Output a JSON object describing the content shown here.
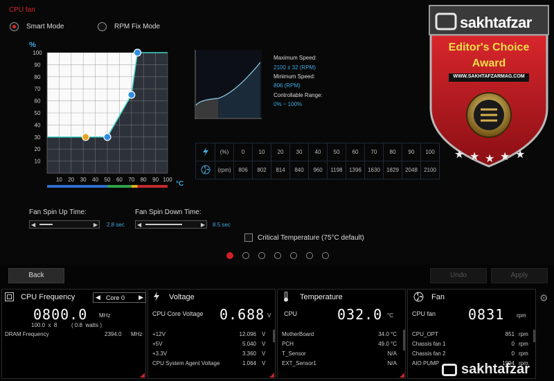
{
  "title": "CPU fan",
  "modes": [
    {
      "label": "Smart Mode",
      "selected": true
    },
    {
      "label": "RPM Fix Mode",
      "selected": false
    }
  ],
  "chart_data": {
    "type": "line",
    "ylabel": "%",
    "xlabel": "°C",
    "xlim": [
      0,
      100
    ],
    "ylim": [
      0,
      100
    ],
    "x_ticks": [
      10,
      20,
      30,
      40,
      50,
      60,
      70,
      80,
      90,
      100
    ],
    "y_ticks": [
      10,
      20,
      30,
      40,
      50,
      60,
      70,
      80,
      90,
      100
    ],
    "points": [
      {
        "x": 0,
        "y": 30
      },
      {
        "x": 32,
        "y": 30
      },
      {
        "x": 50,
        "y": 30
      },
      {
        "x": 70,
        "y": 65
      },
      {
        "x": 75,
        "y": 100
      },
      {
        "x": 100,
        "y": 100
      }
    ],
    "handles": [
      {
        "x": 32,
        "y": 30,
        "color": "#e8a21c"
      },
      {
        "x": 50,
        "y": 30,
        "color": "#2f8ee0"
      },
      {
        "x": 70,
        "y": 65,
        "color": "#2f8ee0"
      },
      {
        "x": 75,
        "y": 100,
        "color": "#2f8ee0"
      }
    ],
    "zones": [
      {
        "from": 0,
        "to": 50,
        "color": "#2f6fd0"
      },
      {
        "from": 50,
        "to": 70,
        "color": "#2fa34a"
      },
      {
        "from": 70,
        "to": 75,
        "color": "#e0b020"
      },
      {
        "from": 75,
        "to": 100,
        "color": "#c42a2a"
      }
    ]
  },
  "specs": {
    "max_label": "Maximum Speed:",
    "max_value": "2100 ± 32 (RPM)",
    "min_label": "Minimum Speed:",
    "min_value": "806 (RPM)",
    "range_label": "Controllable Range:",
    "range_value": "0% ~ 100%"
  },
  "speed_table": {
    "pct_header": "(%)",
    "rpm_header": "(rpm)",
    "pct": [
      "0",
      "10",
      "20",
      "30",
      "40",
      "50",
      "60",
      "70",
      "80",
      "90",
      "100"
    ],
    "rpm": [
      "806",
      "802",
      "814",
      "840",
      "960",
      "1198",
      "1396",
      "1630",
      "1829",
      "2048",
      "2100"
    ]
  },
  "spin_up": {
    "label": "Fan Spin Up Time:",
    "value": "2.8 sec",
    "level": 0.25
  },
  "spin_down": {
    "label": "Fan Spin Down Time:",
    "value": "8.5 sec",
    "level": 0.7
  },
  "critical": {
    "label": "Critical Temperature (75°C default)",
    "checked": false
  },
  "pages": {
    "count": 7,
    "current": 0
  },
  "buttons": {
    "back": "Back",
    "undo": "Undo",
    "apply": "Apply"
  },
  "badge": {
    "brand": "sakhtafzar",
    "line1": "Editor's Choice",
    "line2": "Award",
    "url": "WWW.SAKHTAFZARMAG.COM",
    "stars": 5
  },
  "watermark": "sakhtafzar",
  "cpu": {
    "title": "CPU Frequency",
    "core": "Core 0",
    "freq": "0800.0",
    "unit": "MHz",
    "ratio": "100.0  x  8",
    "watts": "( 0.8  watts )",
    "dram_label": "DRAM Frequency",
    "dram_value": "2394.0",
    "dram_unit": "MHz"
  },
  "voltage": {
    "title": "Voltage",
    "core_label": "CPU Core Voltage",
    "core_value": "0.688",
    "unit": "V",
    "rows": [
      {
        "label": "+12V",
        "value": "12.096",
        "unit": "V"
      },
      {
        "label": "+5V",
        "value": "5.040",
        "unit": "V"
      },
      {
        "label": "+3.3V",
        "value": "3.360",
        "unit": "V"
      },
      {
        "label": "CPU System Agent Voltage",
        "value": "1.064",
        "unit": "V"
      }
    ]
  },
  "temperature": {
    "title": "Temperature",
    "cpu_label": "CPU",
    "cpu_value": "032.0",
    "unit": "°C",
    "rows": [
      {
        "label": "MotherBoard",
        "value": "34.0 °C"
      },
      {
        "label": "PCH",
        "value": "49.0 °C"
      },
      {
        "label": "T_Sensor",
        "value": "N/A"
      },
      {
        "label": "EXT_Sensor1",
        "value": "N/A"
      }
    ]
  },
  "fan": {
    "title": "Fan",
    "cpu_label": "CPU fan",
    "cpu_value": "0831",
    "unit": "rpm",
    "rows": [
      {
        "label": "CPU_OPT",
        "value": "851",
        "unit": "rpm"
      },
      {
        "label": "Chassis fan 1",
        "value": "0",
        "unit": "rpm"
      },
      {
        "label": "Chassis fan 2",
        "value": "0",
        "unit": "rpm"
      },
      {
        "label": "AIO PUMP",
        "value": "1994",
        "unit": "rpm"
      }
    ]
  }
}
